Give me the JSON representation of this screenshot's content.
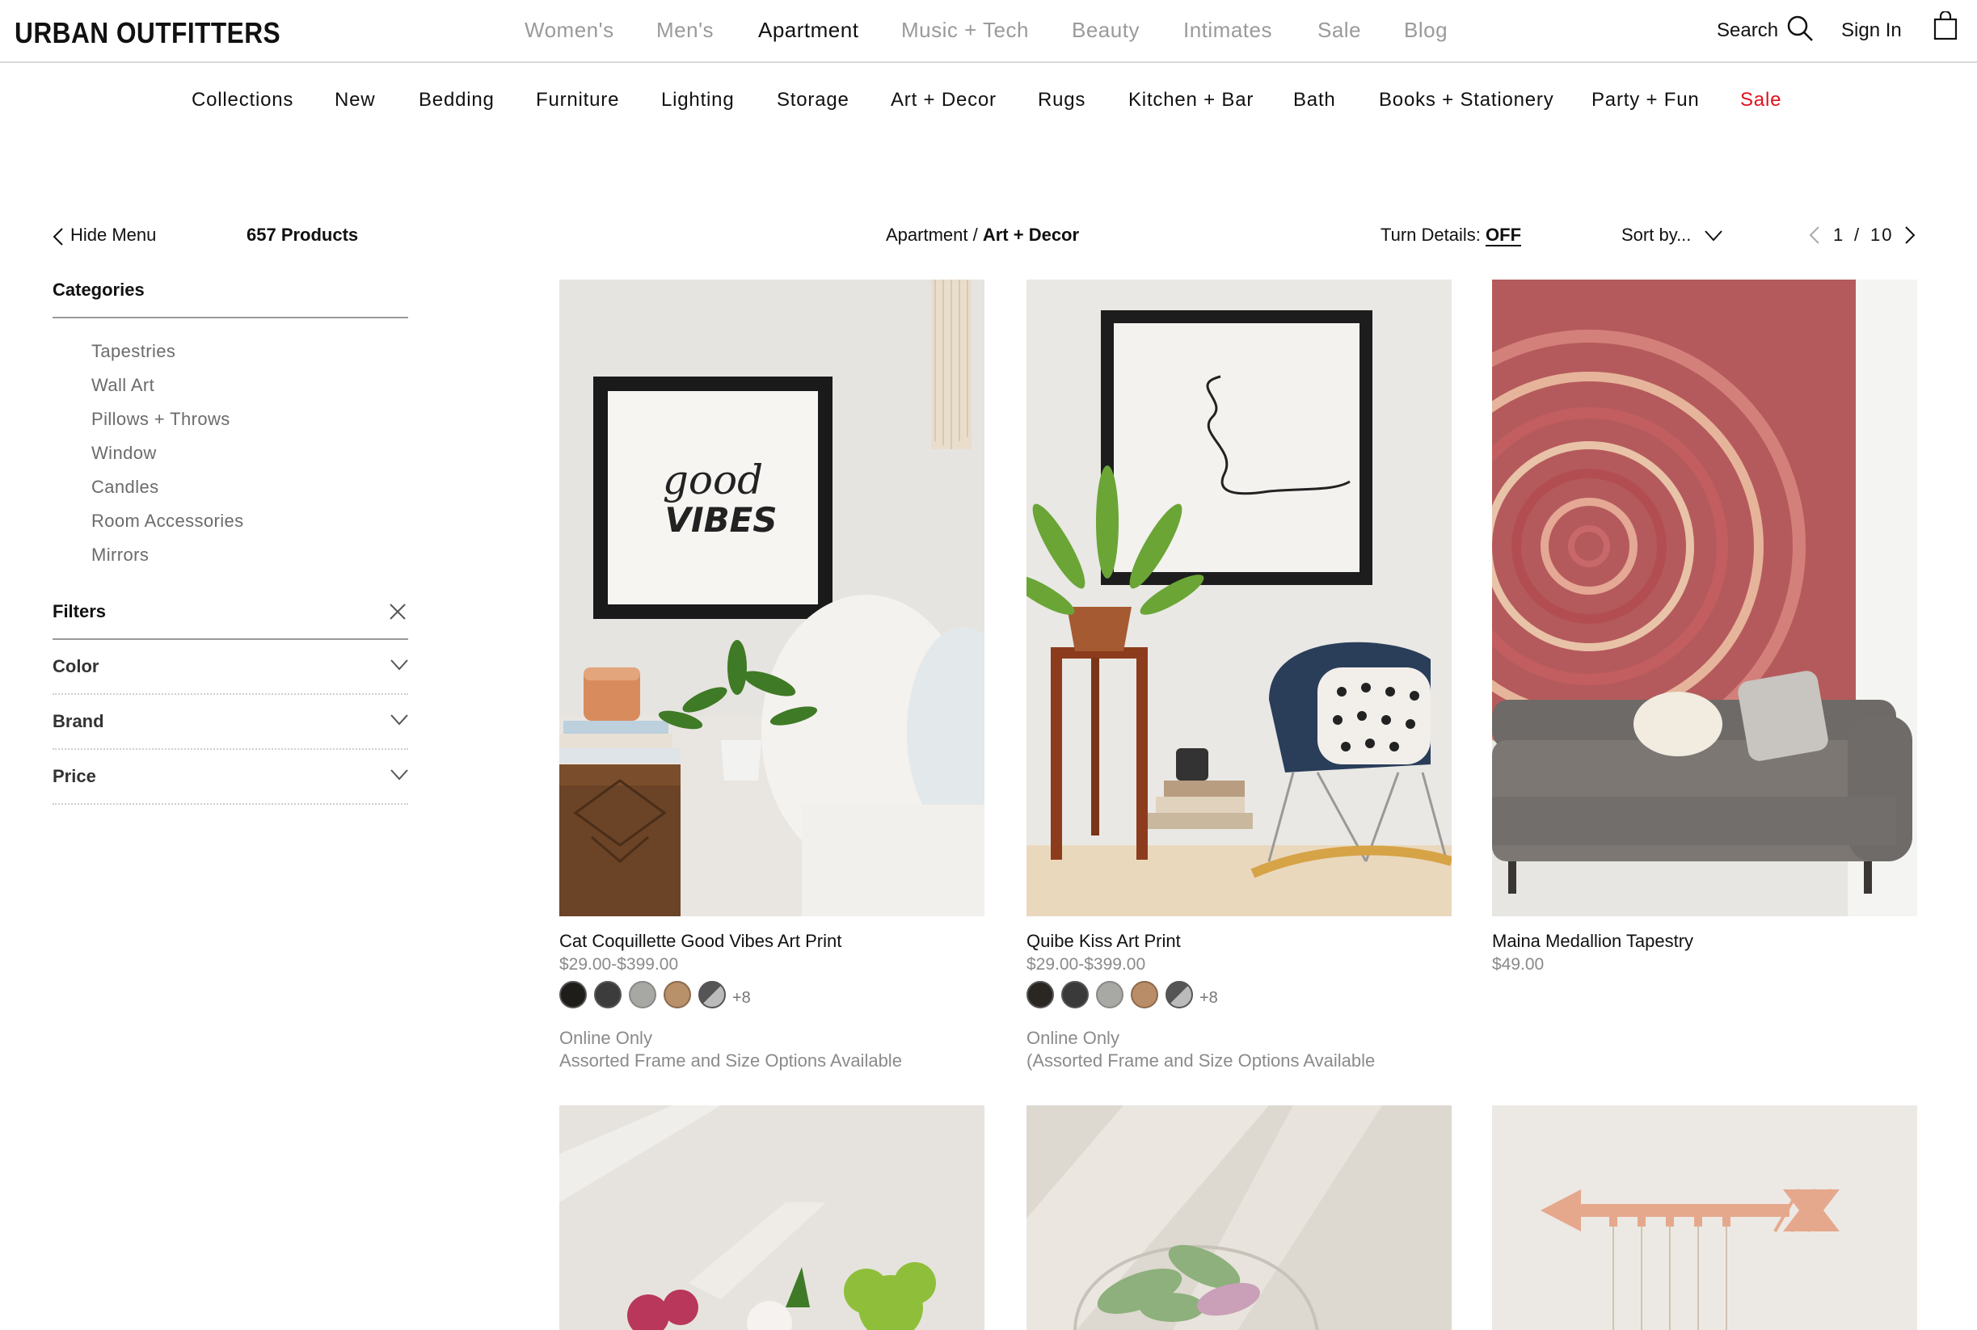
{
  "header": {
    "logo": "URBAN OUTFITTERS",
    "nav": [
      "Women's",
      "Men's",
      "Apartment",
      "Music + Tech",
      "Beauty",
      "Intimates",
      "Sale",
      "Blog"
    ],
    "search_label": "Search",
    "signin_label": "Sign In"
  },
  "subnav": [
    "Collections",
    "New",
    "Bedding",
    "Furniture",
    "Lighting",
    "Storage",
    "Art + Decor",
    "Rugs",
    "Kitchen + Bar",
    "Bath",
    "Books + Stationery",
    "Party + Fun",
    "Sale"
  ],
  "sidebar": {
    "hide_menu": "Hide Menu",
    "products_count": "657 Products",
    "categories_title": "Categories",
    "categories": [
      "Tapestries",
      "Wall Art",
      "Pillows + Throws",
      "Window",
      "Candles",
      "Room Accessories",
      "Mirrors"
    ],
    "filters_title": "Filters",
    "filters": [
      "Color",
      "Brand",
      "Price"
    ]
  },
  "toolbar": {
    "breadcrumb_parent": "Apartment /",
    "breadcrumb_current": "Art + Decor",
    "details_label": "Turn Details:",
    "details_value": "OFF",
    "sort_label": "Sort by...",
    "page_current": "1",
    "page_sep": "/",
    "page_total": "10"
  },
  "products": [
    {
      "name": "Cat Coquillette Good Vibes Art Print",
      "price": "$29.00-$399.00",
      "swatch_colors": [
        "#1e1d1a",
        "#3c3c3c",
        "#a7a7a3",
        "#b8906a",
        "#777"
      ],
      "more": "+8",
      "note1": "Online Only",
      "note2": "Assorted Frame and Size Options Available"
    },
    {
      "name": "Quibe Kiss Art Print",
      "price": "$29.00-$399.00",
      "swatch_colors": [
        "#2a2622",
        "#3a3a3a",
        "#a8a8a4",
        "#b98d68",
        "#777"
      ],
      "more": "+8",
      "note1": "Online Only",
      "note2": "(Assorted Frame and Size Options Available"
    },
    {
      "name": "Maina Medallion Tapestry",
      "price": "$49.00"
    }
  ],
  "art_text": {
    "good": "good",
    "vibes": "VIBES"
  },
  "colors": {
    "sale": "#e0101c",
    "muted": "#9a9a9a"
  }
}
